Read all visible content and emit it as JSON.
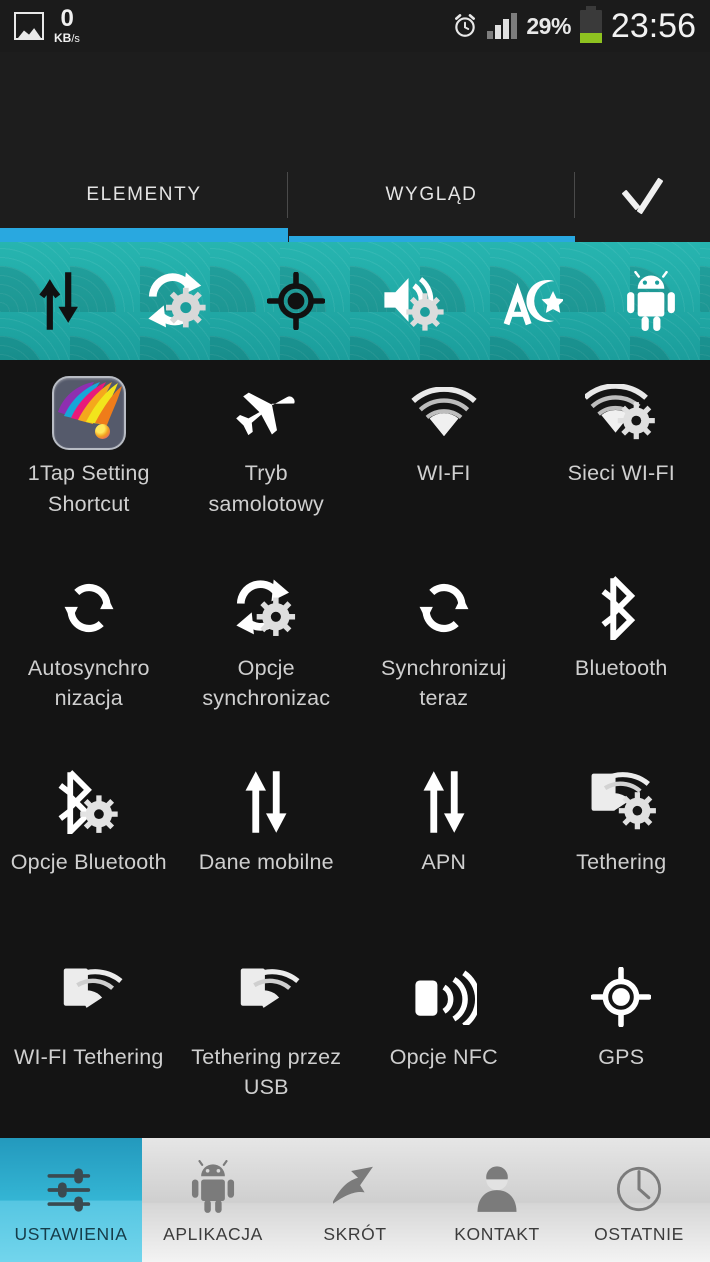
{
  "status_bar": {
    "gallery_icon": "gallery-icon",
    "net_speed_value": "0",
    "net_speed_unit_kb": "KB",
    "net_speed_unit_rate": "/s",
    "alarm_icon": "alarm-clock-icon",
    "signal_icon": "signal-bars-icon",
    "battery_percent": "29%",
    "battery_icon": "battery-icon",
    "clock": "23:56"
  },
  "tabs": {
    "items": [
      {
        "label": "ELEMENTY",
        "active": true
      },
      {
        "label": "WYGLĄD",
        "active": false
      }
    ],
    "confirm_label": "check-icon",
    "accent_color": "#29a8e0"
  },
  "preview": {
    "background_color": "#22ada9",
    "icons": [
      "mobile-data-icon",
      "sync-settings-icon",
      "gps-target-icon",
      "volume-settings-icon",
      "language-icon",
      "android-robot-icon"
    ]
  },
  "grid": {
    "items": [
      {
        "icon": "app-shortcut-icon",
        "label": "1Tap Setting Shortcut"
      },
      {
        "icon": "airplane-icon",
        "label": "Tryb samolotowy"
      },
      {
        "icon": "wifi-icon",
        "label": "WI-FI"
      },
      {
        "icon": "wifi-settings-icon",
        "label": "Sieci WI-FI"
      },
      {
        "icon": "sync-icon",
        "label": "Autosynchro nizacja"
      },
      {
        "icon": "sync-settings-icon",
        "label": "Opcje synchronizac"
      },
      {
        "icon": "sync-now-icon",
        "label": "Synchronizuj teraz"
      },
      {
        "icon": "bluetooth-icon",
        "label": "Bluetooth"
      },
      {
        "icon": "bluetooth-settings-icon",
        "label": "Opcje Bluetooth"
      },
      {
        "icon": "mobile-data-icon",
        "label": "Dane mobilne"
      },
      {
        "icon": "apn-icon",
        "label": "APN"
      },
      {
        "icon": "tethering-settings-icon",
        "label": "Tethering"
      },
      {
        "icon": "wifi-tethering-icon",
        "label": "WI-FI Tethering"
      },
      {
        "icon": "usb-tethering-icon",
        "label": "Tethering przez USB"
      },
      {
        "icon": "nfc-icon",
        "label": "Opcje NFC"
      },
      {
        "icon": "gps-target-icon",
        "label": "GPS"
      }
    ]
  },
  "bottom_nav": {
    "active_color": "#45bcdc",
    "items": [
      {
        "icon": "sliders-icon",
        "label": "USTAWIENIA",
        "active": true
      },
      {
        "icon": "android-robot-icon",
        "label": "APLIKACJA",
        "active": false
      },
      {
        "icon": "shortcut-arrow-icon",
        "label": "SKRÓT",
        "active": false
      },
      {
        "icon": "contact-person-icon",
        "label": "KONTAKT",
        "active": false
      },
      {
        "icon": "clock-icon",
        "label": "OSTATNIE",
        "active": false
      }
    ]
  }
}
